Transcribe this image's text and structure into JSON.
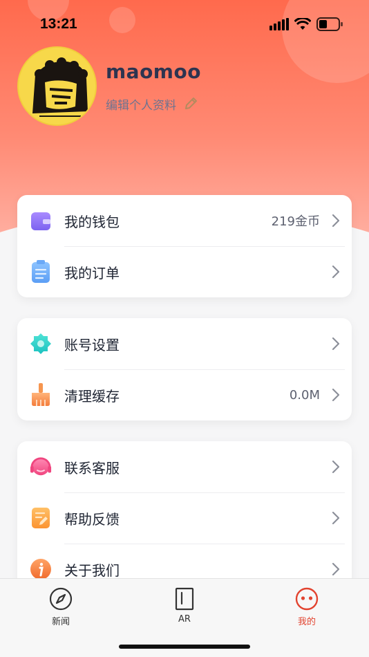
{
  "status_bar": {
    "time": "13:21"
  },
  "profile": {
    "username": "maomoo",
    "edit_label": "编辑个人资料"
  },
  "menu_groups": [
    {
      "items": [
        {
          "label": "我的钱包",
          "value": "219金币",
          "icon": "wallet-icon"
        },
        {
          "label": "我的订单",
          "value": "",
          "icon": "order-icon"
        }
      ]
    },
    {
      "items": [
        {
          "label": "账号设置",
          "value": "",
          "icon": "gear-icon"
        },
        {
          "label": "清理缓存",
          "value": "0.0M",
          "icon": "broom-icon"
        }
      ]
    },
    {
      "items": [
        {
          "label": "联系客服",
          "value": "",
          "icon": "headset-icon"
        },
        {
          "label": "帮助反馈",
          "value": "",
          "icon": "feedback-icon"
        },
        {
          "label": "关于我们",
          "value": "",
          "icon": "info-icon"
        }
      ]
    }
  ],
  "tabbar": {
    "tabs": [
      {
        "label": "新闻",
        "icon": "compass-icon"
      },
      {
        "label": "AR",
        "icon": "door-icon"
      },
      {
        "label": "我的",
        "icon": "smiley-icon",
        "active": true
      }
    ]
  },
  "colors": {
    "accent": "#e2432f",
    "header_gradient_top": "#ff6a4d",
    "header_gradient_bottom": "#ffb3a6"
  }
}
